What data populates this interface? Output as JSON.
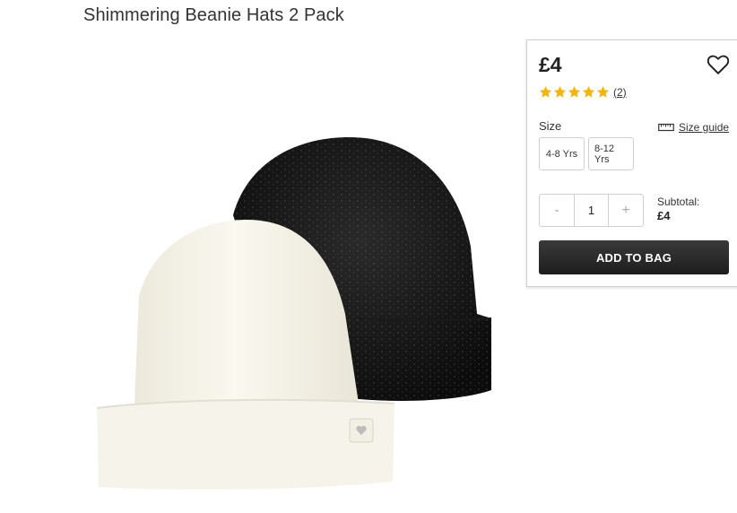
{
  "product": {
    "title": "Shimmering Beanie Hats 2 Pack",
    "price": "£4",
    "rating": {
      "stars": 5,
      "review_count": "(2)"
    },
    "size_label": "Size",
    "size_guide_label": "Size guide",
    "sizes": [
      "4-8 Yrs",
      "8-12 Yrs"
    ],
    "quantity": {
      "minus": "-",
      "value": "1",
      "plus": "+"
    },
    "subtotal_label": "Subtotal:",
    "subtotal_value": "£4",
    "add_to_bag_label": "ADD TO BAG"
  },
  "colors": {
    "star": "#f7b500",
    "button": "#222222",
    "border": "#cfcfcf"
  },
  "icons": {
    "wishlist": "heart-icon",
    "size_guide": "ruler-icon",
    "rating": "star-icon"
  }
}
